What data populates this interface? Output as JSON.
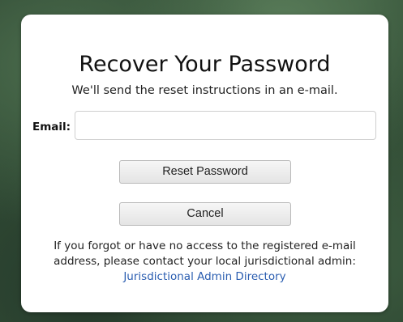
{
  "dialog": {
    "title": "Recover Your Password",
    "subtitle": "We'll send the reset instructions in an e-mail.",
    "email_label": "Email:",
    "email_value": "",
    "email_placeholder": "",
    "reset_button_label": "Reset Password",
    "cancel_button_label": "Cancel",
    "help_line_1": "If you forgot or have no access to the registered e-mail",
    "help_line_2": "address, please contact your local jurisdictional admin:",
    "directory_link_label": "Jurisdictional Admin Directory"
  },
  "colors": {
    "link": "#2a5db0",
    "background": "#2f4a34",
    "dialog": "#ffffff"
  }
}
